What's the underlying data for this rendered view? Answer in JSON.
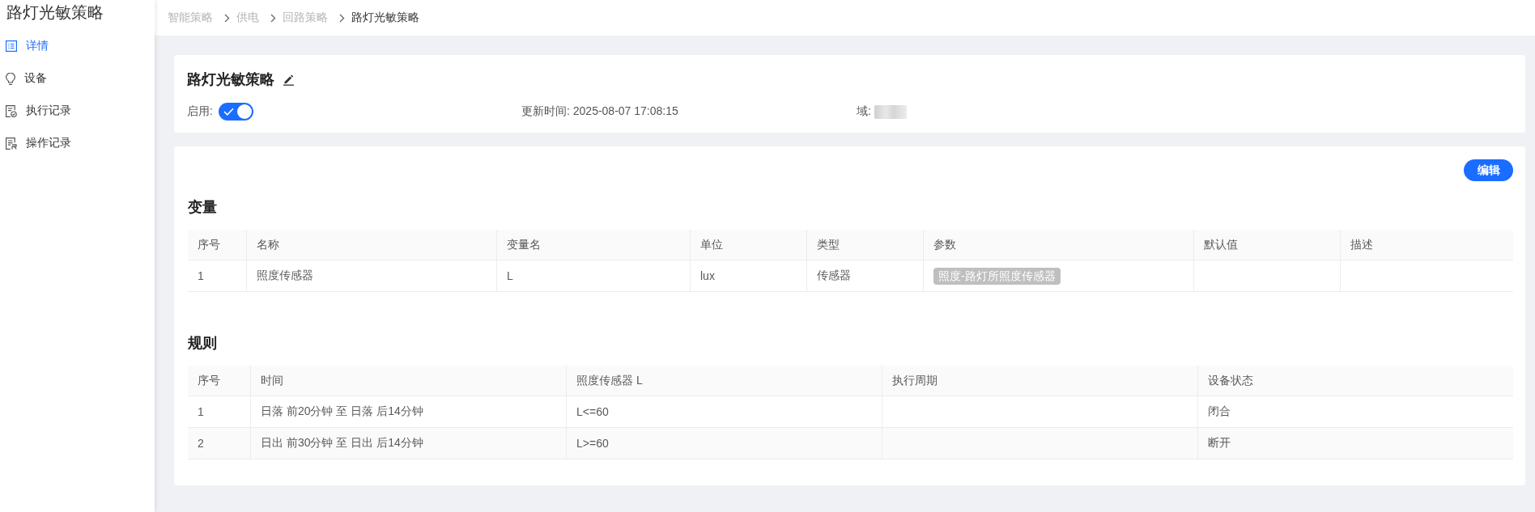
{
  "sidebar": {
    "title": "路灯光敏策略",
    "items": [
      {
        "label": "详情",
        "selected": true
      },
      {
        "label": "设备",
        "selected": false
      },
      {
        "label": "执行记录",
        "selected": false
      },
      {
        "label": "操作记录",
        "selected": false
      }
    ]
  },
  "breadcrumb": [
    {
      "label": "智能策略",
      "current": false
    },
    {
      "label": "供电",
      "current": false
    },
    {
      "label": "回路策略",
      "current": false
    },
    {
      "label": "路灯光敏策略",
      "current": true
    }
  ],
  "header": {
    "title": "路灯光敏策略",
    "enabled": {
      "label": "启用:",
      "on": true
    },
    "updated": "更新时间: 2025-08-07 17:08:15",
    "domain_label": "域:"
  },
  "content": {
    "edit_button": "编辑",
    "variables": {
      "title": "变量",
      "columns": [
        "序号",
        "名称",
        "变量名",
        "单位",
        "类型",
        "参数",
        "默认值",
        "描述"
      ],
      "rows": [
        {
          "number": "1",
          "name": "照度传感器",
          "variable": "L",
          "unit": "lux",
          "type": "传感器",
          "parameters": [
            "照度-路灯所照度传感器"
          ]
        }
      ]
    },
    "rules": {
      "title": "规则",
      "columns": [
        "序号",
        "时间",
        "照度传感器 L",
        "执行周期",
        "设备状态"
      ],
      "rows": [
        {
          "number": "1",
          "time": "日落 前20分钟 至 日落 后14分钟",
          "condition": "L<=60",
          "state": "闭合"
        },
        {
          "number": "2",
          "time": "日出 前30分钟 至 日出 后14分钟",
          "condition": "L>=60",
          "state": "断开"
        }
      ]
    }
  }
}
